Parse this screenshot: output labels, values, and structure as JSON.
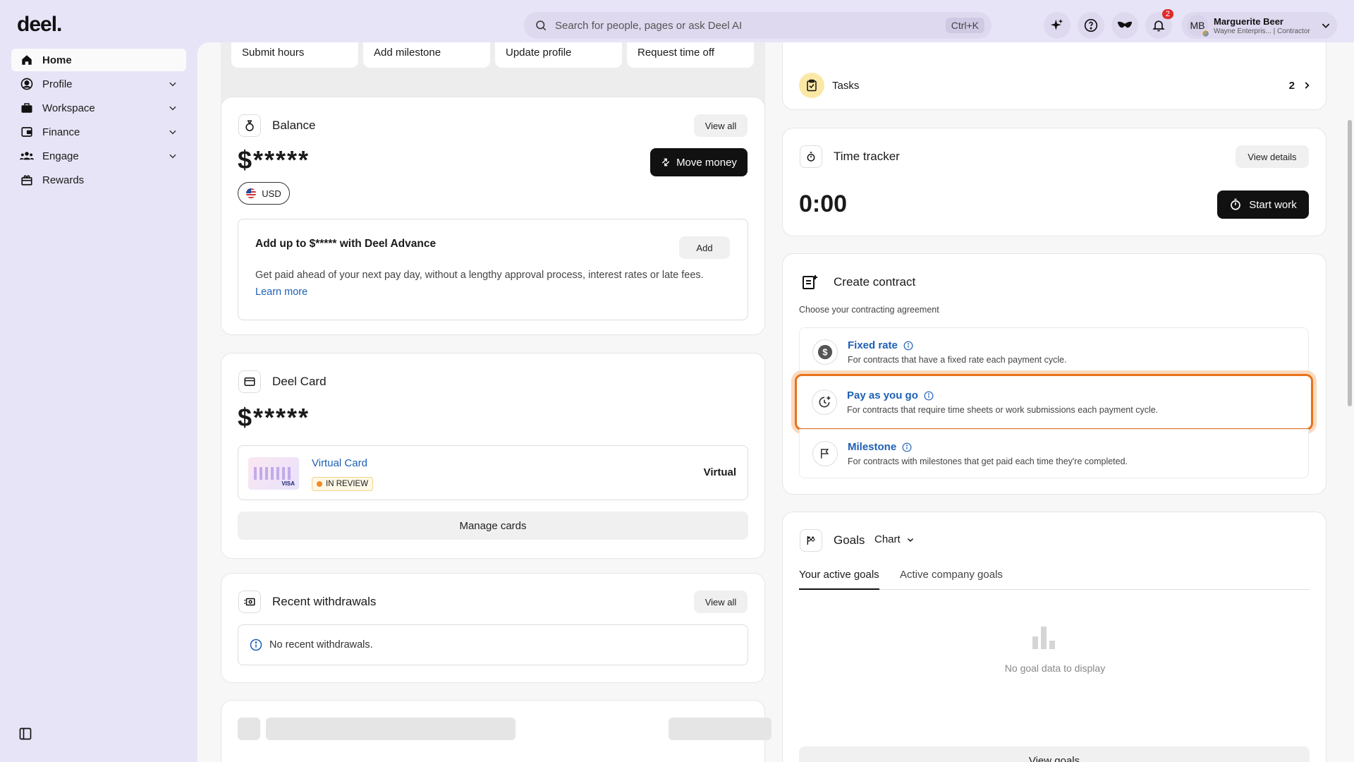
{
  "app": {
    "logo": "deel."
  },
  "search": {
    "placeholder": "Search for people, pages or ask Deel AI",
    "shortcut": "Ctrl+K"
  },
  "notifications": {
    "count": "2"
  },
  "user": {
    "initials": "MB",
    "name": "Marguerite Beer",
    "subtitle": "Wayne Enterpris... | Contractor"
  },
  "sidebar": {
    "items": [
      {
        "label": "Home",
        "icon": "home-icon"
      },
      {
        "label": "Profile",
        "icon": "user-circle-icon"
      },
      {
        "label": "Workspace",
        "icon": "briefcase-icon"
      },
      {
        "label": "Finance",
        "icon": "wallet-icon"
      },
      {
        "label": "Engage",
        "icon": "people-icon"
      },
      {
        "label": "Rewards",
        "icon": "gift-icon"
      }
    ]
  },
  "quick_actions": [
    "Submit hours",
    "Add milestone",
    "Update profile",
    "Request time off"
  ],
  "balance": {
    "title": "Balance",
    "view_all": "View all",
    "amount": "$*****",
    "move_money": "Move money",
    "currency": "USD",
    "advance_title": "Add up to $***** with Deel Advance",
    "advance_add": "Add",
    "advance_desc": "Get paid ahead of your next pay day, without a lengthy approval process, interest rates or late fees.",
    "learn_more": "Learn more"
  },
  "deel_card": {
    "title": "Deel Card",
    "amount": "$*****",
    "card_name": "Virtual Card",
    "status": "IN REVIEW",
    "card_type": "Virtual",
    "manage": "Manage cards"
  },
  "withdrawals": {
    "title": "Recent withdrawals",
    "view_all": "View all",
    "empty": "No recent withdrawals."
  },
  "tasks": {
    "label": "Tasks",
    "count": "2"
  },
  "time_tracker": {
    "title": "Time tracker",
    "view_details": "View details",
    "time": "0:00",
    "start": "Start work"
  },
  "create_contract": {
    "title": "Create contract",
    "subtitle": "Choose your contracting agreement",
    "options": [
      {
        "title": "Fixed rate",
        "desc": "For contracts that have a fixed rate each payment cycle."
      },
      {
        "title": "Pay as you go",
        "desc": "For contracts that require time sheets or work submissions each payment cycle."
      },
      {
        "title": "Milestone",
        "desc": "For contracts with milestones that get paid each time they're completed."
      }
    ]
  },
  "goals": {
    "title": "Goals",
    "view_mode": "Chart",
    "tabs": [
      "Your active goals",
      "Active company goals"
    ],
    "empty": "No goal data to display",
    "view_goals": "View goals"
  },
  "colors": {
    "accent_highlight": "#e8721c",
    "link": "#1d5fb5",
    "background": "#e8e4f7"
  }
}
